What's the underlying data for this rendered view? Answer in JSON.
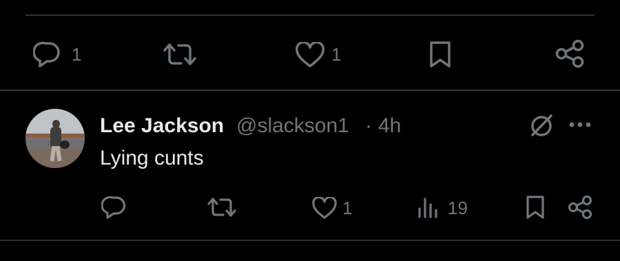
{
  "top_actions": {
    "reply_count": "1",
    "like_count": "1",
    "icons": [
      "reply-icon",
      "retweet-icon",
      "like-icon",
      "bookmark-icon",
      "share-icon"
    ]
  },
  "reply_tweet": {
    "author_name": "Lee Jackson",
    "author_handle": "@slackson1",
    "separator": "·",
    "time": "4h",
    "text": "Lying cunts",
    "like_count": "1",
    "views_count": "19",
    "icons": [
      "grok-icon",
      "more-icon",
      "reply-icon",
      "retweet-icon",
      "like-icon",
      "views-icon",
      "bookmark-icon",
      "share-icon"
    ]
  },
  "colors": {
    "background": "#000000",
    "text_primary": "#e7e9ea",
    "text_secondary": "#71767b",
    "divider": "#2f3336"
  }
}
